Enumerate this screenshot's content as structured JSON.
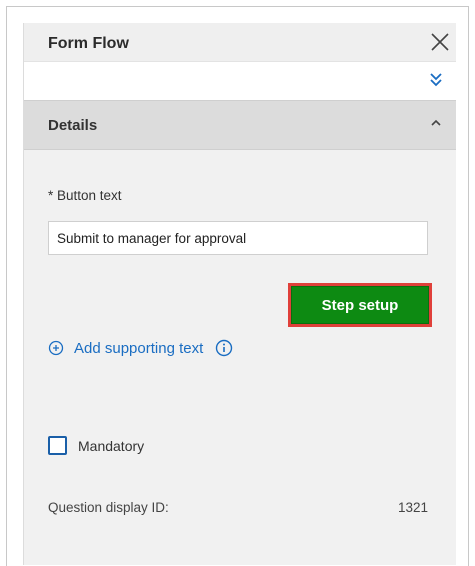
{
  "panel": {
    "title": "Form Flow",
    "section_title": "Details"
  },
  "field": {
    "label": "* Button text",
    "value": "Submit to manager for approval"
  },
  "step_setup_button": "Step setup",
  "add_supporting_text": "Add supporting text",
  "mandatory_label": "Mandatory",
  "question_display": {
    "label": "Question display ID:",
    "value": "1321"
  },
  "colors": {
    "primary_green": "#0d8a12",
    "highlight_red": "#e0403a",
    "link_blue": "#1a6dc2"
  },
  "icons": {
    "close": "close-icon",
    "expand": "double-chevron-down-icon",
    "collapse": "chevron-up-icon",
    "add": "plus-circle-icon",
    "info": "info-icon"
  }
}
